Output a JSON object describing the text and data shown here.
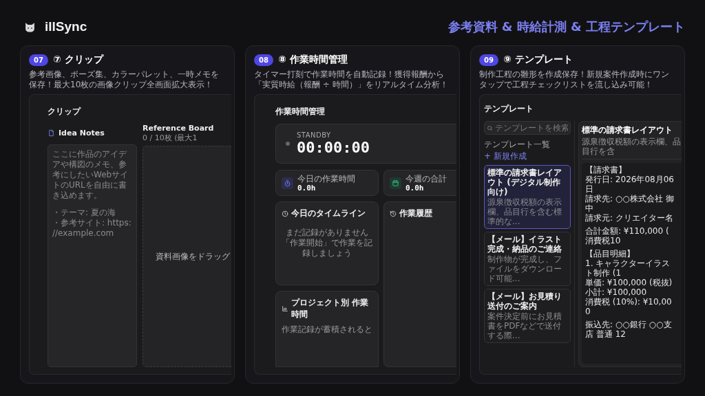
{
  "header": {
    "app_name": "illSync",
    "headline": "参考資料 & 時給計測 & 工程テンプレート"
  },
  "cards": [
    {
      "number": "07",
      "title": "⑦ クリップ",
      "description": "参考画像、ポーズ集、カラーパレット、一時メモを保存！最大10枚の画像クリップ全画面拡大表示！",
      "screen": {
        "kind": "clip",
        "heading": "クリップ",
        "notes_title": "Idea Notes",
        "notes_paragraphs": [
          [
            "ここに作品のアイデアや構図のメモ、参考にしたいWebサイトのURLを自由に書き込めます。"
          ],
          [
            "・テーマ: 夏の海",
            "・参考サイト: https://example.com"
          ]
        ],
        "board_title": "Reference Board",
        "board_count": "0 / 10枚 (最大1",
        "drop_text": "資料画像をドラッグ"
      }
    },
    {
      "number": "08",
      "title": "⑧ 作業時間管理",
      "description": "タイマー打刻で作業時間を自動記録！獲得報酬から「実質時給（報酬 ÷ 時間）」をリアルタイム分析！",
      "screen": {
        "kind": "timer",
        "heading": "作業時間管理",
        "status": "STANDBY",
        "time": "00:00:00",
        "stats": [
          {
            "kind": "stopwatch",
            "label": "今日の作業時間",
            "value": "0.0h",
            "color": "#2d2d4f"
          },
          {
            "kind": "calendar",
            "label": "今週の合計",
            "value": "0.0h",
            "color": "#1d3b30"
          }
        ],
        "timeline_title": "今日のタイムライン",
        "timeline_empty": [
          "まだ記録がありません",
          "「作業開始」で作業を記録しましょう"
        ],
        "history_title": "作業履歴",
        "project_title": "プロジェクト別 作業時間",
        "project_empty": "作業記録が蓄積されると"
      }
    },
    {
      "number": "09",
      "title": "⑨ テンプレート",
      "description": "制作工程の雛形を作成保存！新規案件作成時にワンタップで工程チェックリストを流し込み可能！",
      "screen": {
        "kind": "template",
        "heading": "テンプレート",
        "search_placeholder": "テンプレートを検索",
        "list_label": "テンプレート一覧",
        "new_button": "+ 新規作成",
        "items": [
          {
            "title": "標準の請求書レイアウト (デジタル制作向け)",
            "description": "源泉徴収税額の表示欄、品目行を含む標準的な...",
            "selected": true
          },
          {
            "title": "【メール】イラスト完成・納品のご連絡",
            "description": "制作物が完成し、ファイルをダウンロード可能...",
            "selected": false
          },
          {
            "title": "【メール】お見積り送付のご案内",
            "description": "案件決定前にお見積書をPDFなどで送付する際...",
            "selected": false
          }
        ],
        "detail_title": "標準の請求書レイアウト",
        "detail_description": "源泉徴収税額の表示欄、品目行を含",
        "detail_paragraphs": [
          [
            "【請求書】",
            "発行日: 2026年08月06日",
            "請求先: ○○株式会社 御中",
            "請求元: クリエイター名"
          ],
          [
            "合計金額: ¥110,000 (消費税10"
          ],
          [
            "【品目明細】",
            "1. キャラクターイラスト制作 (1",
            "単価: ¥100,000 (税抜)",
            "小計: ¥100,000",
            "消費税 (10%): ¥10,000"
          ],
          [
            "振込先: ○○銀行 ○○支店 普通 12"
          ]
        ]
      }
    }
  ]
}
